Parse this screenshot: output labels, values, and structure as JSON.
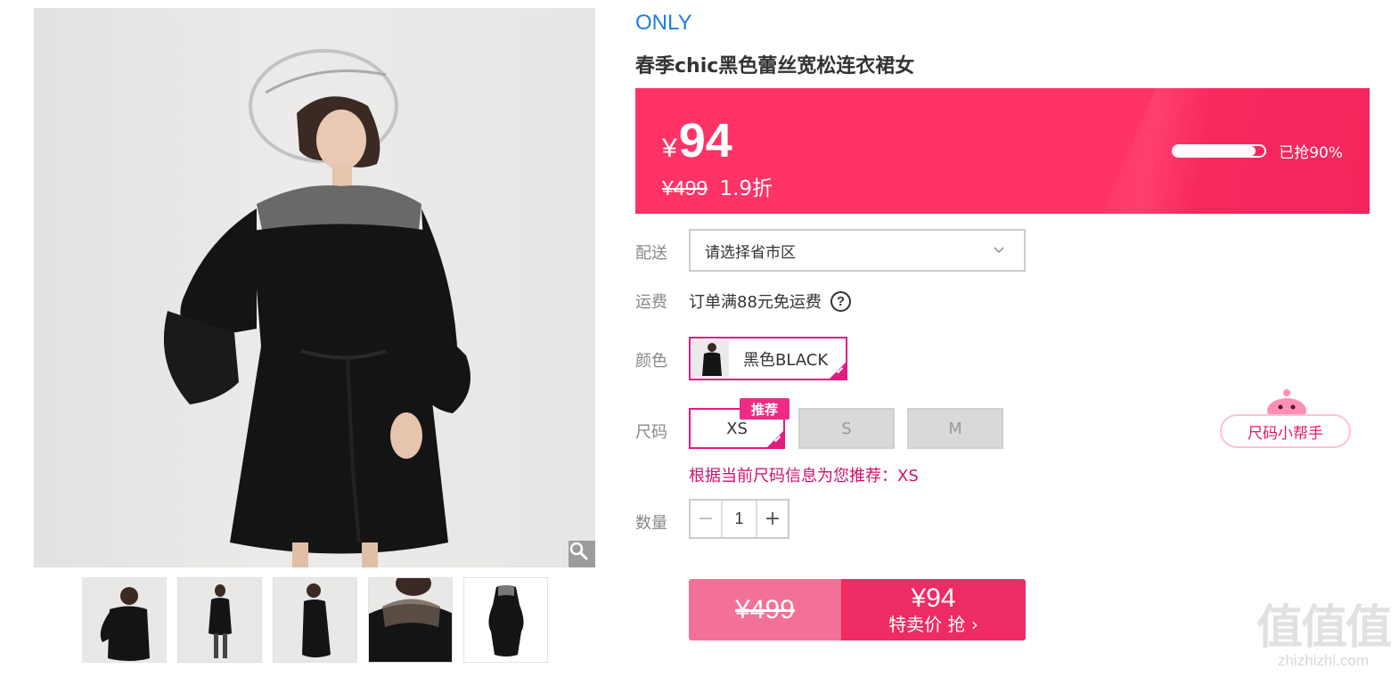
{
  "product": {
    "brand": "ONLY",
    "title": "春季chic黑色蕾丝宽松连衣裙女"
  },
  "price": {
    "currency": "¥",
    "current": "94",
    "original": "¥499",
    "discount": "1.9折",
    "sold_label": "已抢90%",
    "sold_fraction": 0.9
  },
  "delivery": {
    "label": "配送",
    "placeholder": "请选择省市区"
  },
  "freight": {
    "label": "运费",
    "text": "订单满88元免运费"
  },
  "color": {
    "label": "颜色",
    "selected": "黑色BLACK"
  },
  "size": {
    "label": "尺码",
    "options": [
      "XS",
      "S",
      "M"
    ],
    "recommend_tag": "推荐",
    "recommend_note": "根据当前尺码信息为您推荐：XS",
    "helper": "尺码小帮手"
  },
  "quantity": {
    "label": "数量",
    "value": "1",
    "minus": "−",
    "plus": "+"
  },
  "buy": {
    "original_price": "¥499",
    "deal_price": "¥94",
    "deal_label": "特卖价 抢 ›"
  },
  "watermark": {
    "logo": "值值值",
    "url": "zhizhizhi.com"
  },
  "colors": {
    "brand_blue": "#1d7fe0",
    "banner_pink": "#ff3366",
    "accent_magenta": "#e31b7e",
    "buy_light": "#f37198",
    "buy_dark": "#ee2b62"
  },
  "icons": {
    "zoom": "magnifier-icon",
    "chevron": "chevron-down-icon",
    "help": "question-circle-icon",
    "check": "check-corner-icon"
  }
}
